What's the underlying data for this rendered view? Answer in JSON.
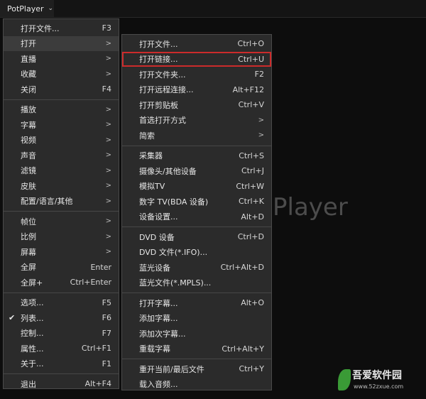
{
  "app": {
    "title": "PotPlayer",
    "watermark": "Player"
  },
  "logo": {
    "title": "吾爱软件园",
    "url": "www.52zxue.com"
  },
  "menu_main": {
    "groups": [
      [
        {
          "label": "打开文件...",
          "shortcut": "F3"
        },
        {
          "label": "打开",
          "submenu": ">"
        },
        {
          "label": "直播",
          "submenu": ">"
        },
        {
          "label": "收藏",
          "submenu": ">"
        },
        {
          "label": "关闭",
          "shortcut": "F4"
        }
      ],
      [
        {
          "label": "播放",
          "submenu": ">"
        },
        {
          "label": "字幕",
          "submenu": ">"
        },
        {
          "label": "视频",
          "submenu": ">"
        },
        {
          "label": "声音",
          "submenu": ">"
        },
        {
          "label": "滤镜",
          "submenu": ">"
        },
        {
          "label": "皮肤",
          "submenu": ">"
        },
        {
          "label": "配置/语言/其他",
          "submenu": ">"
        }
      ],
      [
        {
          "label": "帧位",
          "submenu": ">"
        },
        {
          "label": "比例",
          "submenu": ">"
        },
        {
          "label": "屏幕",
          "submenu": ">"
        },
        {
          "label": "全屏",
          "shortcut": "Enter"
        },
        {
          "label": "全屏+",
          "shortcut": "Ctrl+Enter"
        }
      ],
      [
        {
          "label": "选项...",
          "shortcut": "F5"
        },
        {
          "label": "列表...",
          "shortcut": "F6",
          "checked": "✔"
        },
        {
          "label": "控制...",
          "shortcut": "F7"
        },
        {
          "label": "属性...",
          "shortcut": "Ctrl+F1"
        },
        {
          "label": "关于...",
          "shortcut": "F1"
        }
      ],
      [
        {
          "label": "退出",
          "shortcut": "Alt+F4"
        }
      ]
    ]
  },
  "menu_open": {
    "groups": [
      [
        {
          "label": "打开文件...",
          "shortcut": "Ctrl+O"
        },
        {
          "label": "打开链接...",
          "shortcut": "Ctrl+U"
        },
        {
          "label": "打开文件夹...",
          "shortcut": "F2"
        },
        {
          "label": "打开远程连接...",
          "shortcut": "Alt+F12"
        },
        {
          "label": "打开剪贴板",
          "shortcut": "Ctrl+V"
        },
        {
          "label": "首选打开方式",
          "submenu": ">"
        },
        {
          "label": "简索",
          "submenu": ">"
        }
      ],
      [
        {
          "label": "采集器",
          "shortcut": "Ctrl+S"
        },
        {
          "label": "摄像头/其他设备",
          "shortcut": "Ctrl+J"
        },
        {
          "label": "模拟TV",
          "shortcut": "Ctrl+W"
        },
        {
          "label": "数字 TV(BDA 设备)",
          "shortcut": "Ctrl+K"
        },
        {
          "label": "设备设置...",
          "shortcut": "Alt+D"
        }
      ],
      [
        {
          "label": "DVD 设备",
          "shortcut": "Ctrl+D"
        },
        {
          "label": "DVD 文件(*.IFO)..."
        },
        {
          "label": "蓝光设备",
          "shortcut": "Ctrl+Alt+D"
        },
        {
          "label": "蓝光文件(*.MPLS)..."
        }
      ],
      [
        {
          "label": "打开字幕...",
          "shortcut": "Alt+O"
        },
        {
          "label": "添加字幕..."
        },
        {
          "label": "添加次字幕..."
        },
        {
          "label": "重载字幕",
          "shortcut": "Ctrl+Alt+Y"
        }
      ],
      [
        {
          "label": "重开当前/最后文件",
          "shortcut": "Ctrl+Y"
        },
        {
          "label": "载入音频..."
        }
      ]
    ]
  }
}
